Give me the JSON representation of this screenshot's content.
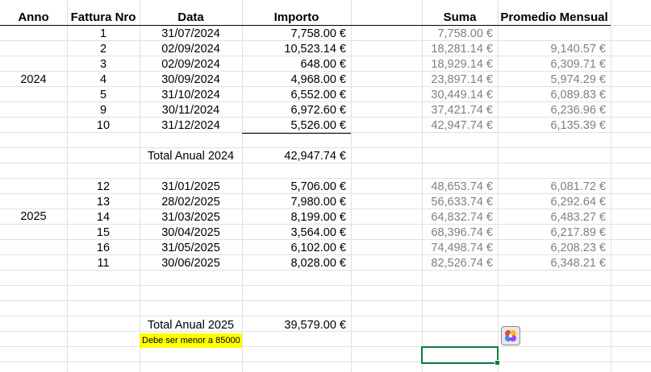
{
  "headers": {
    "anno": "Anno",
    "fattura": "Fattura Nro",
    "data": "Data",
    "importo": "Importo",
    "suma": "Suma",
    "promedio": "Promedio Mensual"
  },
  "year_2024": {
    "label": "2024",
    "rows": [
      {
        "nro": "1",
        "data": "31/07/2024",
        "importo": "7,758.00 €",
        "suma": "7,758.00 €",
        "promedio": ""
      },
      {
        "nro": "2",
        "data": "02/09/2024",
        "importo": "10,523.14 €",
        "suma": "18,281.14 €",
        "promedio": "9,140.57 €"
      },
      {
        "nro": "3",
        "data": "02/09/2024",
        "importo": "648.00 €",
        "suma": "18,929.14 €",
        "promedio": "6,309.71 €"
      },
      {
        "nro": "4",
        "data": "30/09/2024",
        "importo": "4,968.00 €",
        "suma": "23,897.14 €",
        "promedio": "5,974.29 €"
      },
      {
        "nro": "5",
        "data": "31/10/2024",
        "importo": "6,552.00 €",
        "suma": "30,449.14 €",
        "promedio": "6,089.83 €"
      },
      {
        "nro": "9",
        "data": "30/11/2024",
        "importo": "6,972.60 €",
        "suma": "37,421.74 €",
        "promedio": "6,236.96 €"
      },
      {
        "nro": "10",
        "data": "31/12/2024",
        "importo": "5,526.00 €",
        "suma": "42,947.74 €",
        "promedio": "6,135.39 €"
      }
    ],
    "total_label": "Total Anual 2024",
    "total_value": "42,947.74 €"
  },
  "year_2025": {
    "label": "2025",
    "rows": [
      {
        "nro": "12",
        "data": "31/01/2025",
        "importo": "5,706.00 €",
        "suma": "48,653.74 €",
        "promedio": "6,081.72 €"
      },
      {
        "nro": "13",
        "data": "28/02/2025",
        "importo": "7,980.00 €",
        "suma": "56,633.74 €",
        "promedio": "6,292.64 €"
      },
      {
        "nro": "14",
        "data": "31/03/2025",
        "importo": "8,199.00 €",
        "suma": "64,832.74 €",
        "promedio": "6,483.27 €"
      },
      {
        "nro": "15",
        "data": "30/04/2025",
        "importo": "3,564.00 €",
        "suma": "68,396.74 €",
        "promedio": "6,217.89 €"
      },
      {
        "nro": "16",
        "data": "31/05/2025",
        "importo": "6,102.00 €",
        "suma": "74,498.74 €",
        "promedio": "6,208.23 €"
      },
      {
        "nro": "11",
        "data": "30/06/2025",
        "importo": "8,028.00 €",
        "suma": "82,526.74 €",
        "promedio": "6,348.21 €"
      }
    ],
    "total_label": "Total Anual 2025",
    "total_value": "39,579.00 €",
    "note": "Debe ser menor a 85000"
  },
  "colors": {
    "gridline": "#e1e1e1",
    "formula_text": "#808080",
    "highlight": "#ffff00",
    "selection": "#107c41"
  },
  "icons": {
    "copilot": "copilot-icon"
  }
}
